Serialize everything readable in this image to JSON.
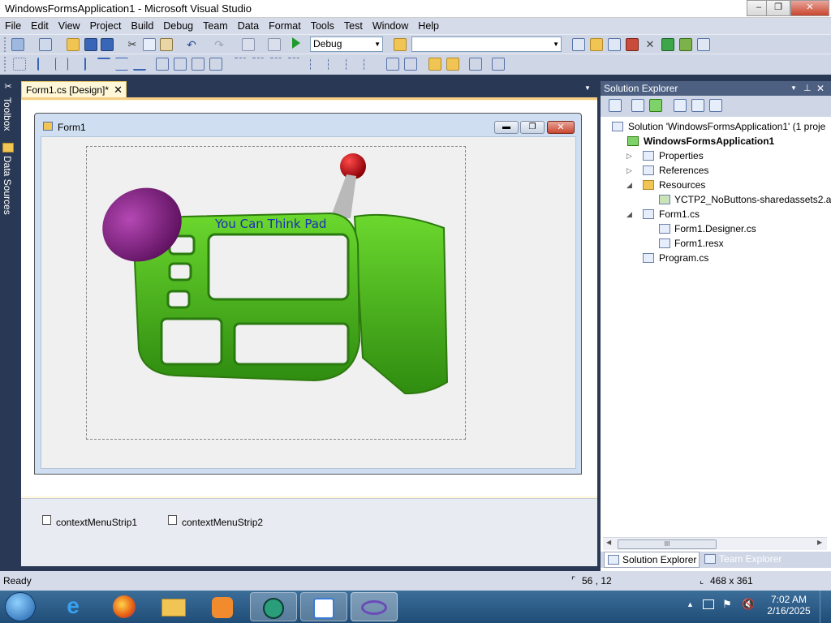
{
  "window": {
    "title": "WindowsFormsApplication1 - Microsoft Visual Studio",
    "controls": {
      "minimize": "–",
      "restore": "❐",
      "close": "✕"
    }
  },
  "menu": [
    "File",
    "Edit",
    "View",
    "Project",
    "Build",
    "Debug",
    "Team",
    "Data",
    "Format",
    "Tools",
    "Test",
    "Window",
    "Help"
  ],
  "toolbar": {
    "config_value": "Debug",
    "platform_value": "",
    "play_icon": "play-icon"
  },
  "left_tabs": [
    "Toolbox",
    "Data Sources"
  ],
  "document": {
    "tab_label": "Form1.cs [Design]*",
    "form_title": "Form1",
    "image_caption": "You Can Think Pad",
    "tray_items": [
      "contextMenuStrip1",
      "contextMenuStrip2"
    ]
  },
  "solution_explorer": {
    "title": "Solution Explorer",
    "tree": [
      {
        "label": "Solution 'WindowsFormsApplication1' (1 proje",
        "level": 0,
        "expander": ""
      },
      {
        "label": "WindowsFormsApplication1",
        "level": 1,
        "expander": "◢",
        "bold": true
      },
      {
        "label": "Properties",
        "level": 2,
        "expander": "▷"
      },
      {
        "label": "References",
        "level": 2,
        "expander": "▷"
      },
      {
        "label": "Resources",
        "level": 2,
        "expander": "◢"
      },
      {
        "label": "YCTP2_NoButtons-sharedassets2.as",
        "level": 3,
        "expander": ""
      },
      {
        "label": "Form1.cs",
        "level": 2,
        "expander": "◢"
      },
      {
        "label": "Form1.Designer.cs",
        "level": 3,
        "expander": ""
      },
      {
        "label": "Form1.resx",
        "level": 3,
        "expander": ""
      },
      {
        "label": "Program.cs",
        "level": 2,
        "expander": ""
      }
    ],
    "bottom_tabs": [
      "Solution Explorer",
      "Team Explorer"
    ],
    "scroll_thumb": "III"
  },
  "status": {
    "text": "Ready",
    "position": "56 , 12",
    "size": "468 x 361"
  },
  "taskbar": {
    "time": "7:02 AM",
    "date": "2/16/2025"
  },
  "colors": {
    "vs_background": "#293955",
    "designer_tab": "#fff7d8",
    "pad_green": "#4cc21b",
    "pad_purple": "#8b1f8c",
    "pad_red": "#c0121a"
  }
}
